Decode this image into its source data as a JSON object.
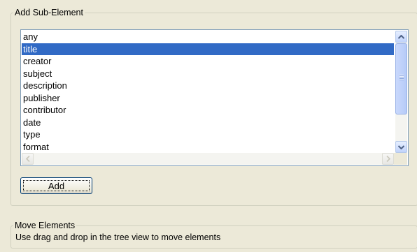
{
  "add_group": {
    "title": "Add Sub-Element",
    "list": {
      "items": [
        "any",
        "title",
        "creator",
        "subject",
        "description",
        "publisher",
        "contributor",
        "date",
        "type",
        "format"
      ],
      "selected_index": 1
    },
    "add_button_label": "Add"
  },
  "move_group": {
    "title": "Move Elements",
    "hint": "Use drag and drop in the tree view to move elements"
  },
  "colors": {
    "panel_bg": "#ece9d8",
    "selection": "#316ac5",
    "group_border": "#d0d0bf"
  },
  "icons": {
    "scroll_up": "chevron-up-icon",
    "scroll_down": "chevron-down-icon",
    "scroll_left": "chevron-left-icon",
    "scroll_right": "chevron-right-icon"
  }
}
